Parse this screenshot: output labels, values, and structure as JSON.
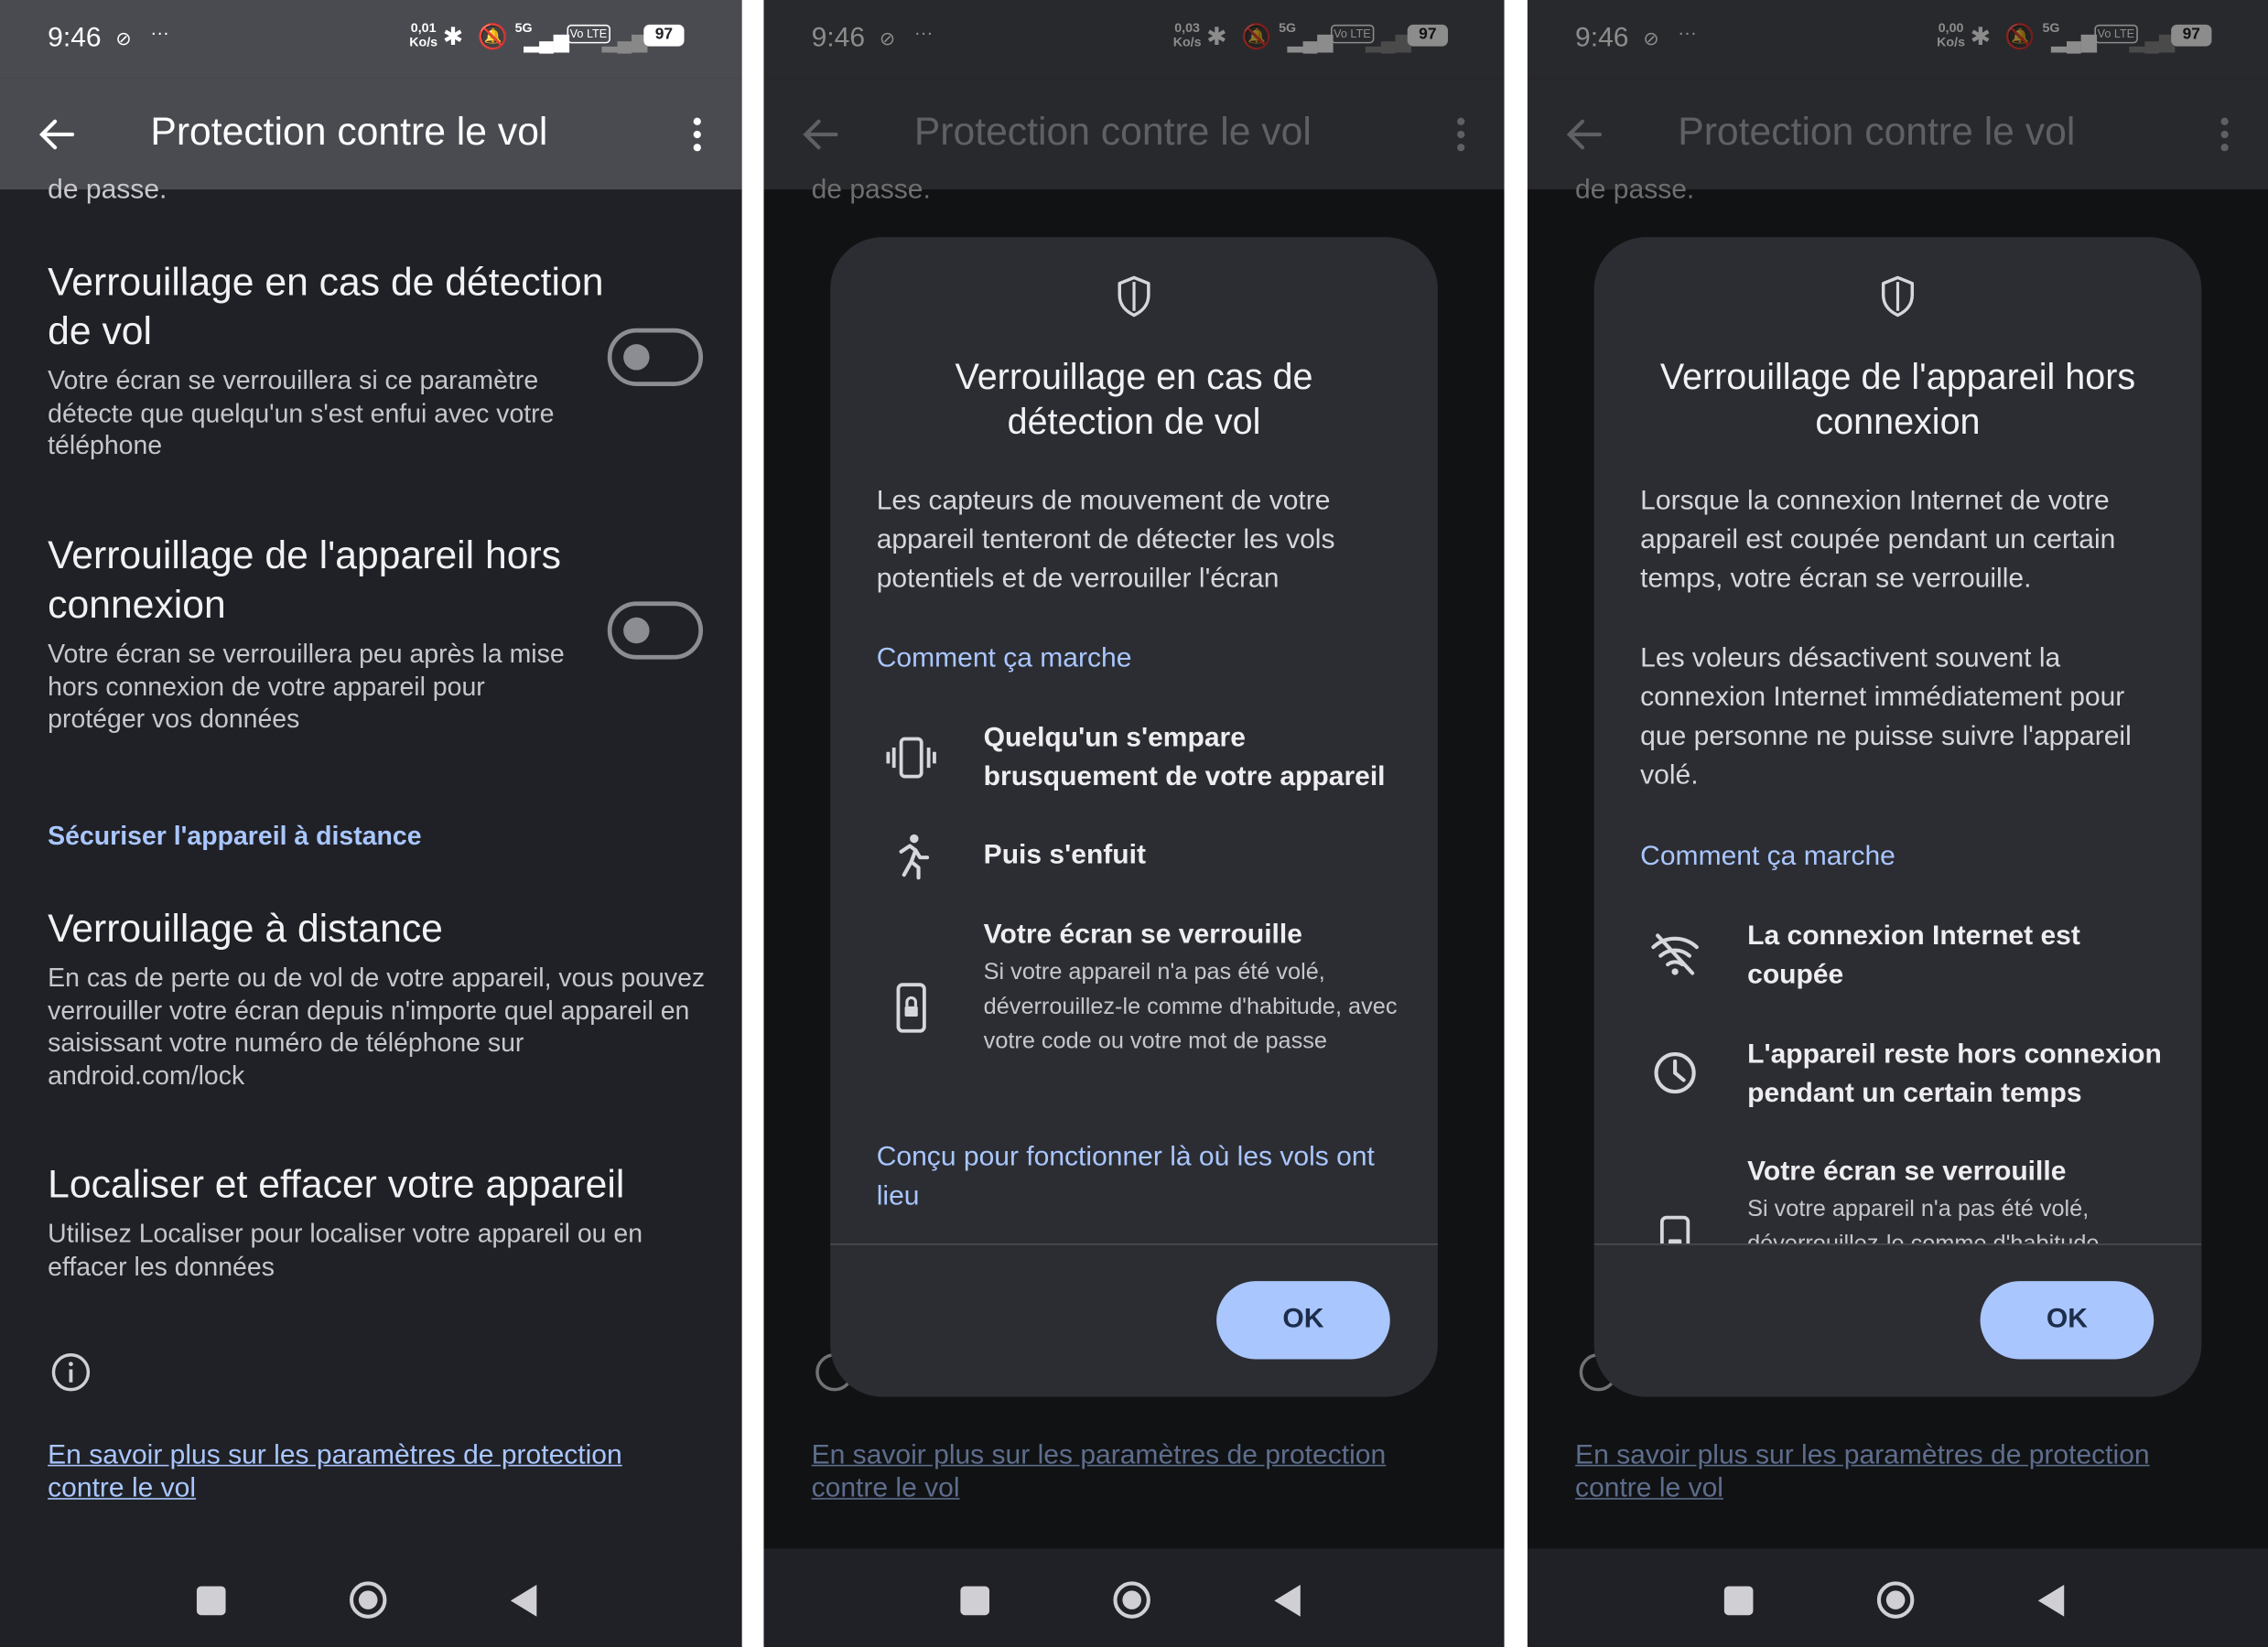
{
  "status": {
    "time": "9:46",
    "speeds": [
      "0,01",
      "0,03",
      "0,00"
    ],
    "speed_unit": "Ko/s",
    "network": "5G",
    "volte": "Vo LTE",
    "battery": "97"
  },
  "appbar": {
    "title": "Protection contre le vol"
  },
  "settings": {
    "cut_text": "de passe.",
    "theft_lock": {
      "title": "Verrouillage en cas de détection de vol",
      "desc": "Votre écran se verrouillera si ce paramètre détecte que quelqu'un s'est enfui avec votre téléphone",
      "enabled": false
    },
    "offline_lock": {
      "title": "Verrouillage de l'appareil hors connexion",
      "desc": "Votre écran se verrouillera peu après la mise hors connexion de votre appareil pour protéger vos données",
      "enabled": false
    },
    "section_remote": "Sécuriser l'appareil à distance",
    "remote_lock": {
      "title": "Verrouillage à distance",
      "desc": "En cas de perte ou de vol de votre appareil, vous pouvez verrouiller votre écran depuis n'importe quel appareil en saisissant votre numéro de téléphone sur android.com/lock"
    },
    "find": {
      "title": "Localiser et effacer votre appareil",
      "desc": "Utilisez Localiser pour localiser votre appareil ou en effacer les données"
    },
    "learn_more": "En savoir plus sur les paramètres de protection contre le vol"
  },
  "dialog1": {
    "title": "Verrouillage en cas de détection de vol",
    "body": "Les capteurs de mouvement de votre appareil tenteront de détecter les vols potentiels et de verrouiller l'écran",
    "how_link": "Comment ça marche",
    "steps": [
      {
        "icon": "phone-vibrate-icon",
        "title": "Quelqu'un s'empare brusquement de votre appareil"
      },
      {
        "icon": "running-person-icon",
        "title": "Puis s'enfuit"
      },
      {
        "icon": "phone-lock-icon",
        "title": "Votre écran se verrouille",
        "sub": "Si votre appareil n'a pas été volé, déverrouillez-le comme d'habitude, avec votre code ou votre mot de passe"
      }
    ],
    "footer_link": "Conçu pour fonctionner là où les vols ont lieu",
    "ok": "OK"
  },
  "dialog2": {
    "title": "Verrouillage de l'appareil hors connexion",
    "body1": "Lorsque la connexion Internet de votre appareil est coupée pendant un certain temps, votre écran se verrouille.",
    "body2": "Les voleurs désactivent souvent la connexion Internet immédiatement pour que personne ne puisse suivre l'appareil volé.",
    "how_link": "Comment ça marche",
    "steps": [
      {
        "icon": "wifi-off-icon",
        "title": "La connexion Internet est coupée"
      },
      {
        "icon": "clock-icon",
        "title": "L'appareil reste hors connexion pendant un certain temps"
      },
      {
        "icon": "phone-lock-icon",
        "title": "Votre écran se verrouille",
        "sub": "Si votre appareil n'a pas été volé, déverrouillez-le comme d'habitude"
      }
    ],
    "ok": "OK"
  },
  "colors": {
    "accent": "#a9c6ff",
    "background": "#202126",
    "appbar": "#4a4b51",
    "dialog": "#2c2d32"
  }
}
